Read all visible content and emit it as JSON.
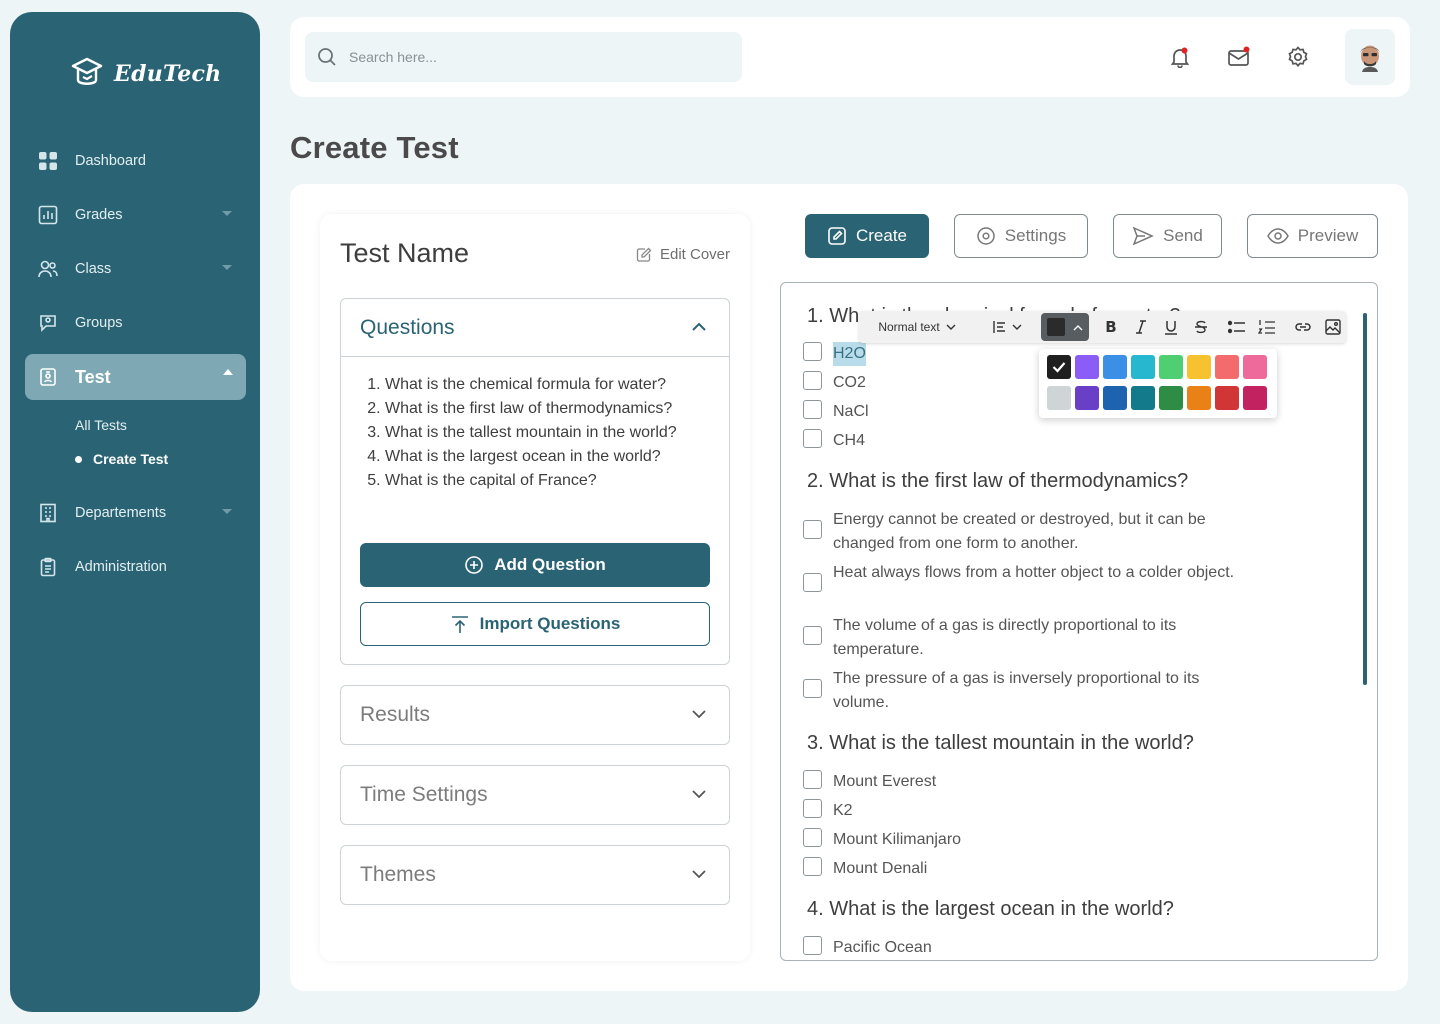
{
  "brand": {
    "name": "EduTech"
  },
  "sidebar": {
    "items": [
      {
        "label": "Dashboard",
        "icon": "grid-icon"
      },
      {
        "label": "Grades",
        "icon": "bar-chart-icon"
      },
      {
        "label": "Class",
        "icon": "users-icon"
      },
      {
        "label": "Groups",
        "icon": "user-chat-icon"
      },
      {
        "label": "Test",
        "icon": "id-badge-icon"
      },
      {
        "label": "Departements",
        "icon": "building-icon"
      },
      {
        "label": "Administration",
        "icon": "clipboard-icon"
      }
    ],
    "test_sub": [
      {
        "label": "All Tests"
      },
      {
        "label": "Create Test"
      }
    ]
  },
  "search": {
    "placeholder": "Search here..."
  },
  "page": {
    "title": "Create Test"
  },
  "left": {
    "test_name": "Test Name",
    "edit_cover": "Edit Cover",
    "questions_title": "Questions",
    "questions": [
      "What is the chemical formula for water?",
      "What is the first law of thermodynamics?",
      "What is the tallest mountain in the world?",
      "What is the largest ocean in the world?",
      "What is the capital of France?"
    ],
    "add_question": "Add Question",
    "import_questions": "Import Questions",
    "results": "Results",
    "time_settings": "Time Settings",
    "themes": "Themes"
  },
  "tabs": {
    "create": "Create",
    "settings": "Settings",
    "send": "Send",
    "preview": "Preview"
  },
  "editor": {
    "toolbar": {
      "text_style": "Normal text",
      "selected_color": "#2b2b2b"
    },
    "palette": [
      "#1f1f1f",
      "#8b5cf6",
      "#3b8fe4",
      "#27b7cf",
      "#4fcf72",
      "#f7c230",
      "#f46b6b",
      "#ee6a9a",
      "#cfd4d7",
      "#6a3fc7",
      "#1e63b0",
      "#127a8a",
      "#2f8c45",
      "#e98116",
      "#d23535",
      "#c2225f"
    ],
    "q1": {
      "title": "1. What is the chemical formula for water?",
      "options": [
        "H2O",
        "CO2",
        "NaCl",
        "CH4"
      ]
    },
    "q2": {
      "title": "2. What is the first law of thermodynamics?",
      "options": [
        "Energy cannot be created or destroyed, but it can be changed from one form to another.",
        "Heat always flows from a hotter object to a colder object.",
        "The volume of a gas is directly proportional to its temperature.",
        "The pressure of a gas is inversely proportional to its volume."
      ]
    },
    "q3": {
      "title": "3. What is the tallest mountain in the world?",
      "options": [
        "Mount Everest",
        "K2",
        "Mount Kilimanjaro",
        "Mount Denali"
      ]
    },
    "q4": {
      "title": "4. What is the largest ocean in the world?",
      "options": [
        "Pacific Ocean"
      ]
    }
  },
  "colors": {
    "primary": "#2a6474",
    "background": "#eef5f7",
    "active_nav": "#7ea8b3",
    "notification": "#e02424"
  }
}
